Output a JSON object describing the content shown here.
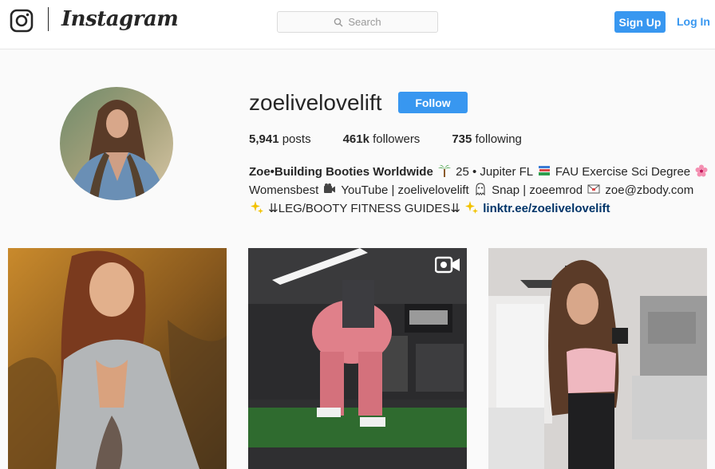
{
  "header": {
    "brand": "Instagram",
    "search_placeholder": "Search",
    "signup_label": "Sign Up",
    "login_label": "Log In"
  },
  "profile": {
    "username": "zoelivelovelift",
    "follow_label": "Follow",
    "stats": {
      "posts_count": "5,941",
      "posts_label": "posts",
      "followers_count": "461k",
      "followers_label": "followers",
      "following_count": "735",
      "following_label": "following"
    },
    "bio": {
      "name": "Zoe•Building Booties Worldwide",
      "line1_a": "25 • Jupiter FL",
      "line1_b": "FAU Exercise Sci Degree",
      "line2_a": "Womensbest",
      "line2_b": "YouTube | zoelivelovelift",
      "line2_c": "Snap | zoeemrod",
      "line2_d": "zoe@zbody.com",
      "line3_a": "⇊LEG/BOOTY FITNESS GUIDES⇊",
      "link": "linktr.ee/zoelivelovelift"
    }
  },
  "posts": [
    {
      "kind": "photo",
      "icon": "none"
    },
    {
      "kind": "video",
      "icon": "video-camera-icon"
    },
    {
      "kind": "photo",
      "icon": "none"
    }
  ],
  "colors": {
    "accent": "#3897f0",
    "link": "#003569",
    "background": "#fafafa"
  }
}
